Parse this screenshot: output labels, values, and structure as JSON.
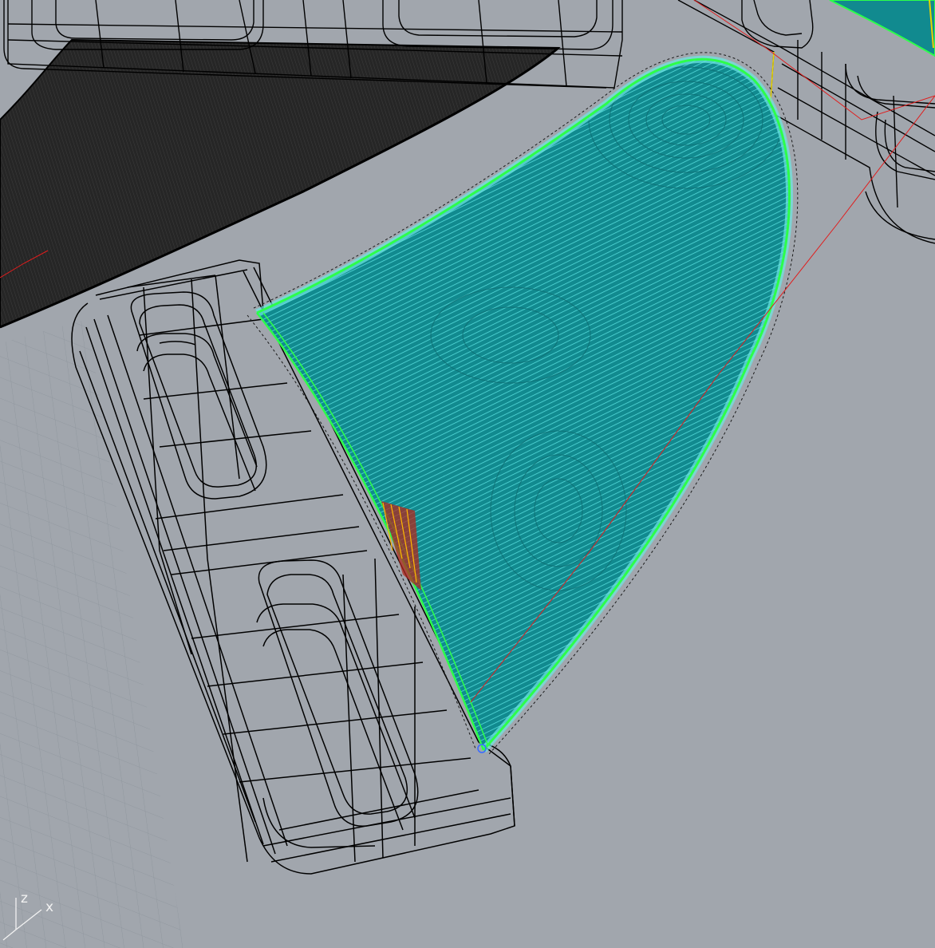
{
  "viewport": {
    "background": "#a1a6ad",
    "grid_color": "#8f969e",
    "wire_color": "#000000",
    "fin_fill": "#12898e",
    "fin_stripe": "#4fd8d8",
    "fin_outline": "#2cff4a",
    "dark_fin_fill": "#2b2b2b",
    "selection_line": "#e11d1d"
  },
  "axis_widget": {
    "z_label": "z",
    "x_label": "x",
    "icon": "axis-gizmo-icon"
  }
}
